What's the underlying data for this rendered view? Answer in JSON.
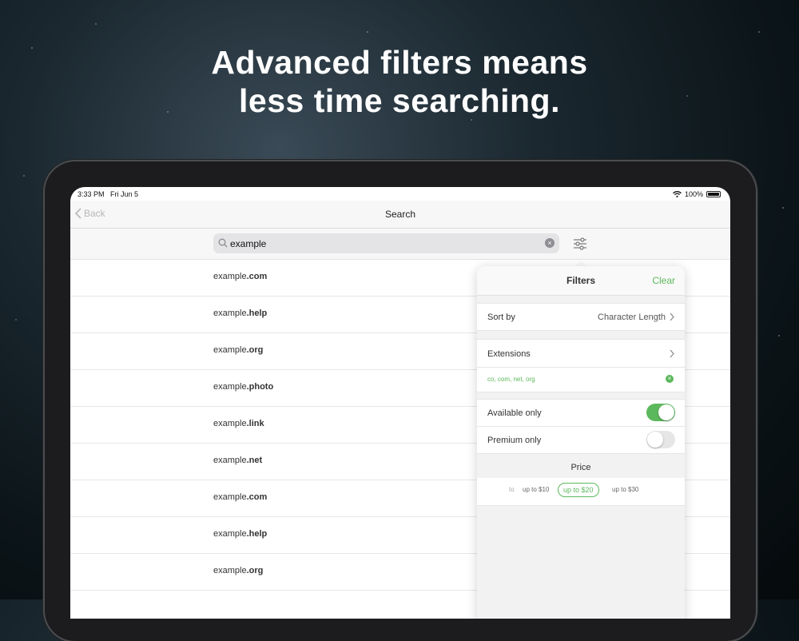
{
  "headline": {
    "line1": "Advanced filters means",
    "line2": "less time searching."
  },
  "status": {
    "time": "3:33 PM",
    "date": "Fri Jun 5",
    "battery": "100%"
  },
  "nav": {
    "back_label": "Back",
    "title": "Search"
  },
  "search": {
    "value": "example",
    "clear_icon": "clear-circle-icon"
  },
  "results": [
    {
      "base": "example",
      "tld": ".com"
    },
    {
      "base": "example",
      "tld": ".help"
    },
    {
      "base": "example",
      "tld": ".org"
    },
    {
      "base": "example",
      "tld": ".photo"
    },
    {
      "base": "example",
      "tld": ".link"
    },
    {
      "base": "example",
      "tld": ".net"
    },
    {
      "base": "example",
      "tld": ".com"
    },
    {
      "base": "example",
      "tld": ".help"
    },
    {
      "base": "example",
      "tld": ".org"
    }
  ],
  "filters": {
    "title": "Filters",
    "clear_label": "Clear",
    "sort_label": "Sort by",
    "sort_value": "Character Length",
    "extensions_label": "Extensions",
    "extensions_value": "co, com, net, org",
    "available_label": "Available only",
    "available_on": true,
    "premium_label": "Premium only",
    "premium_on": false,
    "price_label": "Price",
    "price_options": [
      "up to $10",
      "up to $20",
      "up to $30"
    ],
    "price_partial": "to",
    "price_selected": "up to $20"
  },
  "colors": {
    "accent": "#5cb85c"
  }
}
